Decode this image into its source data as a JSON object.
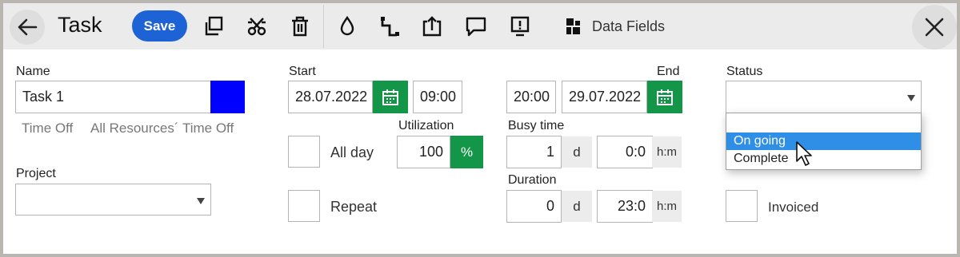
{
  "toolbar": {
    "title": "Task",
    "save_label": "Save",
    "data_fields_label": "Data Fields",
    "icons": [
      "back-icon",
      "copy-icon",
      "cut-icon",
      "trash-icon",
      "drop-icon",
      "link-icon",
      "export-icon",
      "comment-icon",
      "alert-icon",
      "data-fields-icon",
      "close-icon"
    ]
  },
  "name": {
    "label": "Name",
    "value": "Task 1",
    "color": "#0000ff",
    "time_off_label": "Time Off",
    "all_resources_time_off_label": "All Resources´ Time Off"
  },
  "project": {
    "label": "Project",
    "value": ""
  },
  "start": {
    "label": "Start",
    "date": "28.07.2022",
    "time": "09:00"
  },
  "end": {
    "label": "End",
    "time": "20:00",
    "date": "29.07.2022"
  },
  "utilization": {
    "label": "Utilization",
    "value": "100",
    "unit": "%"
  },
  "all_day": {
    "label": "All day",
    "checked": false
  },
  "repeat": {
    "label": "Repeat",
    "checked": false
  },
  "busy_time": {
    "label": "Busy time",
    "days": "1",
    "days_unit": "d",
    "time": "0:0",
    "time_unit": "h:m"
  },
  "duration": {
    "label": "Duration",
    "days": "0",
    "days_unit": "d",
    "time": "23:0",
    "time_unit": "h:m"
  },
  "status": {
    "label": "Status",
    "value": "",
    "options": [
      "",
      "On going",
      "Complete"
    ],
    "highlighted": "On going"
  },
  "invoiced": {
    "label": "Invoiced",
    "checked": false
  },
  "colors": {
    "accent": "#1d63d6",
    "green": "#149648",
    "highlight": "#2f8fe6"
  }
}
